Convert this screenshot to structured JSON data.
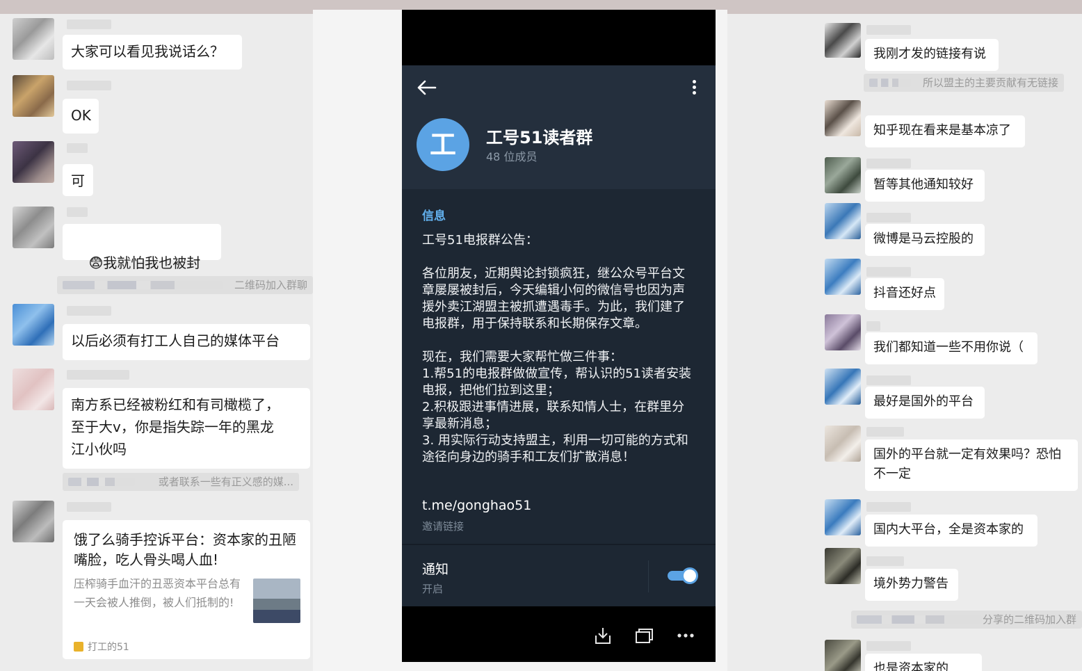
{
  "left_chat": {
    "messages": [
      {
        "text": "大家可以看见我说话么？"
      },
      {
        "text": "OK"
      },
      {
        "text": "可"
      },
      {
        "emoji": "😨",
        "text": "我就怕我也被封了"
      },
      {
        "text": "以后必须有打工人自己的媒体平台"
      },
      {
        "text": "南方系已经被粉红和有司橄榄了，\n至于大v，你是指失踪一年的黑龙\n江小伙吗"
      }
    ],
    "notices": [
      "二维码加入群聊",
      "或者联系一些有正义感的媒..."
    ],
    "card": {
      "title": "饿了么骑手控诉平台：资本家的丑陋嘴脸，吃人骨头喝人血!",
      "description": "压榨骑手血汗的丑恶资本平台总有一天会被人推倒，被人们抵制的!",
      "source": "打工的51"
    }
  },
  "telegram": {
    "group_avatar_letter": "工",
    "group_title": "工号51读者群",
    "member_count": "48 位成员",
    "info_section_label": "信息",
    "announcement": "工号51电报群公告：\n\n各位朋友，近期舆论封锁疯狂，继公众号平台文章屡屡被封后，今天编辑小何的微信号也因为声援外卖江湖盟主被抓遭遇毒手。为此，我们建了电报群，用于保持联系和长期保存文章。\n\n现在，我们需要大家帮忙做三件事：\n1.帮51的电报群做做宣传，帮认识的51读者安装电报，把他们拉到这里；\n2.积极跟进事情进展，联系知情人士，在群里分享最新消息；\n3. 用实际行动支持盟主，利用一切可能的方式和途径向身边的骑手和工友们扩散消息！",
    "invite_link": "t.me/gonghao51",
    "invite_link_label": "邀请链接",
    "notifications_label": "通知",
    "notifications_state": "开启",
    "notifications_on": true,
    "accent_color": "#5ba3e4",
    "header_color": "#242f3d",
    "body_color": "#1d2733"
  },
  "right_chat": {
    "messages": [
      {
        "text": "我刚才发的链接有说"
      },
      {
        "text": "知乎现在看来是基本凉了"
      },
      {
        "text": "暂等其他通知较好"
      },
      {
        "text": "微博是马云控股的"
      },
      {
        "text": "抖音还好点"
      },
      {
        "text": "我们都知道一些不用你说（"
      },
      {
        "text": "最好是国外的平台"
      },
      {
        "text": "国外的平台就一定有效果吗？恐怕\n不一定"
      },
      {
        "text": "国内大平台，全是资本家的"
      },
      {
        "text": "境外势力警告"
      },
      {
        "text": "也是资本家的"
      }
    ],
    "notices": [
      "所以盟主的主要贡献有无链接",
      "分享的二维码加入群"
    ]
  }
}
